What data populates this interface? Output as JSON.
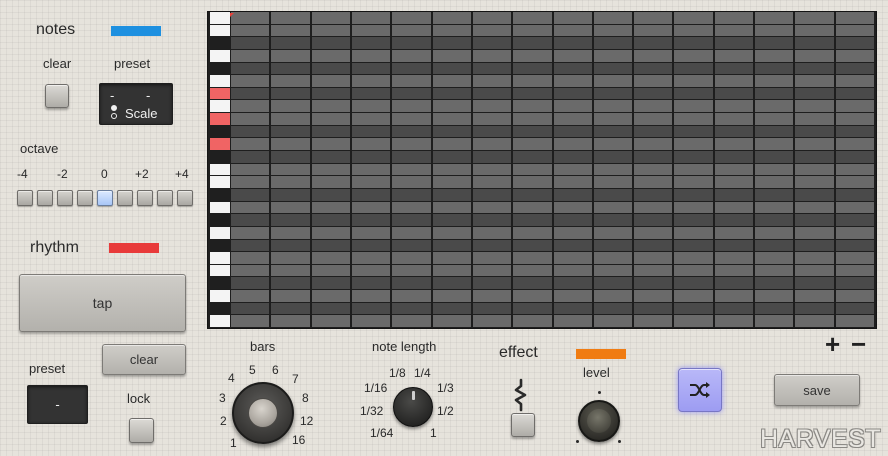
{
  "colors": {
    "notes": "#1e90e0",
    "rhythm": "#e83a3a",
    "effect": "#f07c12",
    "key_active": "#f06464",
    "octave_active": "#b8d0f8",
    "shuffle": "#b9b8f8"
  },
  "notes_section": {
    "title": "notes",
    "clear_label": "clear",
    "preset_label": "preset",
    "preset_display": {
      "line1_left": "-",
      "line1_right": "-",
      "mode": "Scale"
    }
  },
  "octave": {
    "title": "octave",
    "ticks": [
      "-4",
      "-2",
      "0",
      "+2",
      "+4"
    ],
    "selected_index": 4,
    "count": 9
  },
  "rhythm_section": {
    "title": "rhythm",
    "tap_label": "tap",
    "clear_label": "clear",
    "preset_label": "preset",
    "preset_value": "-",
    "lock_label": "lock"
  },
  "bars": {
    "title": "bars",
    "ticks": [
      "1",
      "2",
      "3",
      "4",
      "5",
      "6",
      "7",
      "8",
      "12",
      "16"
    ]
  },
  "note_length": {
    "title": "note length",
    "ticks": [
      "1/64",
      "1/32",
      "1/16",
      "1/8",
      "1/4",
      "1/3",
      "1/2",
      "1"
    ]
  },
  "effect": {
    "title": "effect",
    "level_label": "level",
    "icon": "squiggle-icon"
  },
  "grid": {
    "columns": 16,
    "rows": 25,
    "active_keys": [
      6,
      8,
      10
    ],
    "zoom_in": "+",
    "zoom_out": "−"
  },
  "shuffle_icon": "shuffle-icon",
  "save_label": "save",
  "brand": "HARVEST"
}
